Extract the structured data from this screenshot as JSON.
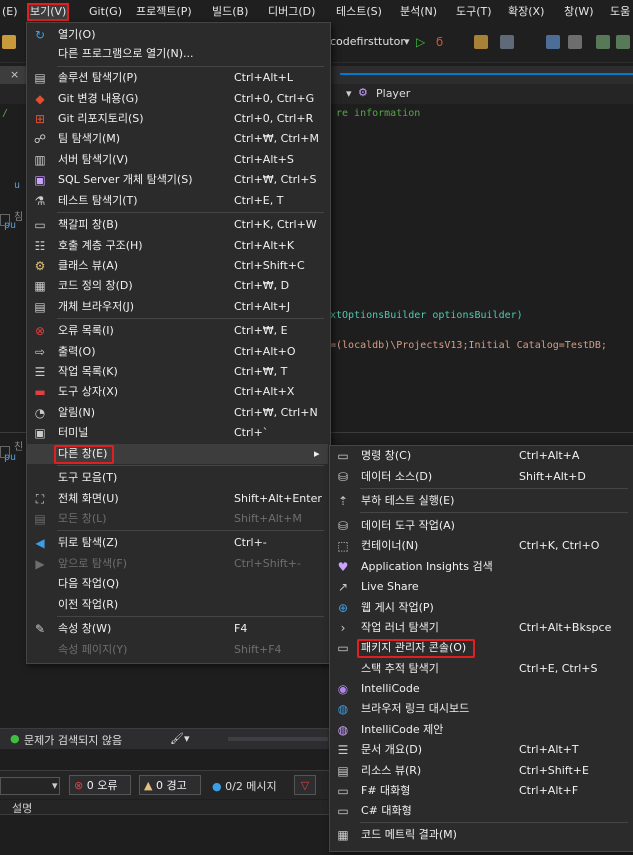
{
  "menubar": {
    "items": [
      "(E)",
      "보기(V)",
      "Git(G)",
      "프로젝트(P)",
      "빌드(B)",
      "디버그(D)",
      "테스트(S)",
      "분석(N)",
      "도구(T)",
      "확장(X)",
      "창(W)",
      "도움"
    ]
  },
  "toolbar": {
    "project": "codefirsttutor"
  },
  "navbar": {
    "member": "Player"
  },
  "code": {
    "line1": "re information",
    "line2": "xtOptionsBuilder optionsBuilder)",
    "line3": "=(localdb)\\ProjectsV13;Initial Catalog=TestDB;",
    "frag_u": "u",
    "frag_g1": "침",
    "frag_g2": "친",
    "frag_p": "pu"
  },
  "view_menu": [
    {
      "label": "열기(O)",
      "shortcut": "",
      "icon": "open-icon",
      "disabled": false
    },
    {
      "label": "다른 프로그램으로 열기(N)...",
      "shortcut": "",
      "icon": "",
      "disabled": false
    },
    {
      "label": "솔루션 탐색기(P)",
      "shortcut": "Ctrl+Alt+L",
      "icon": "solution-explorer-icon",
      "disabled": false
    },
    {
      "label": "Git 변경 내용(G)",
      "shortcut": "Ctrl+0, Ctrl+G",
      "icon": "git-changes-icon",
      "disabled": false
    },
    {
      "label": "Git 리포지토리(S)",
      "shortcut": "Ctrl+0, Ctrl+R",
      "icon": "git-repository-icon",
      "disabled": false
    },
    {
      "label": "팀 탐색기(M)",
      "shortcut": "Ctrl+₩, Ctrl+M",
      "icon": "team-explorer-icon",
      "disabled": false
    },
    {
      "label": "서버 탐색기(V)",
      "shortcut": "Ctrl+Alt+S",
      "icon": "server-explorer-icon",
      "disabled": false
    },
    {
      "label": "SQL Server 개체 탐색기(S)",
      "shortcut": "Ctrl+₩, Ctrl+S",
      "icon": "sql-server-icon",
      "disabled": false
    },
    {
      "label": "테스트 탐색기(T)",
      "shortcut": "Ctrl+E, T",
      "icon": "test-explorer-icon",
      "disabled": false
    },
    {
      "label": "책갈피 창(B)",
      "shortcut": "Ctrl+K, Ctrl+W",
      "icon": "bookmark-icon",
      "disabled": false
    },
    {
      "label": "호출 계층 구조(H)",
      "shortcut": "Ctrl+Alt+K",
      "icon": "call-hierarchy-icon",
      "disabled": false
    },
    {
      "label": "클래스 뷰(A)",
      "shortcut": "Ctrl+Shift+C",
      "icon": "class-view-icon",
      "disabled": false
    },
    {
      "label": "코드 정의 창(D)",
      "shortcut": "Ctrl+₩, D",
      "icon": "code-definition-icon",
      "disabled": false
    },
    {
      "label": "개체 브라우저(J)",
      "shortcut": "Ctrl+Alt+J",
      "icon": "object-browser-icon",
      "disabled": false
    },
    {
      "label": "오류 목록(I)",
      "shortcut": "Ctrl+₩, E",
      "icon": "error-list-icon",
      "disabled": false
    },
    {
      "label": "출력(O)",
      "shortcut": "Ctrl+Alt+O",
      "icon": "output-icon",
      "disabled": false
    },
    {
      "label": "작업 목록(K)",
      "shortcut": "Ctrl+₩, T",
      "icon": "task-list-icon",
      "disabled": false
    },
    {
      "label": "도구 상자(X)",
      "shortcut": "Ctrl+Alt+X",
      "icon": "toolbox-icon",
      "disabled": false
    },
    {
      "label": "알림(N)",
      "shortcut": "Ctrl+₩, Ctrl+N",
      "icon": "bell-icon",
      "disabled": false
    },
    {
      "label": "터미널",
      "shortcut": "Ctrl+`",
      "icon": "terminal-icon",
      "disabled": false
    },
    {
      "label": "다른 창(E)",
      "shortcut": "",
      "icon": "",
      "disabled": false
    },
    {
      "label": "도구 모음(T)",
      "shortcut": "",
      "icon": "",
      "disabled": false
    },
    {
      "label": "전체 화면(U)",
      "shortcut": "Shift+Alt+Enter",
      "icon": "fullscreen-icon",
      "disabled": false
    },
    {
      "label": "모든 창(L)",
      "shortcut": "Shift+Alt+M",
      "icon": "all-windows-icon",
      "disabled": true
    },
    {
      "label": "뒤로 탐색(Z)",
      "shortcut": "Ctrl+-",
      "icon": "back-icon",
      "disabled": false
    },
    {
      "label": "앞으로 탐색(F)",
      "shortcut": "Ctrl+Shift+-",
      "icon": "forward-icon",
      "disabled": true
    },
    {
      "label": "다음 작업(Q)",
      "shortcut": "",
      "icon": "",
      "disabled": false
    },
    {
      "label": "이전 작업(R)",
      "shortcut": "",
      "icon": "",
      "disabled": false
    },
    {
      "label": "속성 창(W)",
      "shortcut": "F4",
      "icon": "wrench-icon",
      "disabled": false
    },
    {
      "label": "속성 페이지(Y)",
      "shortcut": "Shift+F4",
      "icon": "",
      "disabled": true
    }
  ],
  "submenu": [
    {
      "label": "명령 창(C)",
      "shortcut": "Ctrl+Alt+A",
      "icon": "command-window-icon"
    },
    {
      "label": "데이터 소스(D)",
      "shortcut": "Shift+Alt+D",
      "icon": "data-source-icon"
    },
    {
      "label": "부하 테스트 실행(E)",
      "shortcut": "",
      "icon": "load-test-icon"
    },
    {
      "label": "데이터 도구 작업(A)",
      "shortcut": "",
      "icon": "data-tools-icon"
    },
    {
      "label": "컨테이너(N)",
      "shortcut": "Ctrl+K, Ctrl+O",
      "icon": "container-icon"
    },
    {
      "label": "Application Insights 검색",
      "shortcut": "",
      "icon": "app-insights-icon"
    },
    {
      "label": "Live Share",
      "shortcut": "",
      "icon": "live-share-icon"
    },
    {
      "label": "웹 게시 작업(P)",
      "shortcut": "",
      "icon": "web-publish-icon"
    },
    {
      "label": "작업 러너 탐색기",
      "shortcut": "Ctrl+Alt+Bkspce",
      "icon": "chevron-right-icon"
    },
    {
      "label": "패키지 관리자 콘솔(O)",
      "shortcut": "",
      "icon": "package-manager-icon"
    },
    {
      "label": "스택 추적 탐색기",
      "shortcut": "Ctrl+E, Ctrl+S",
      "icon": ""
    },
    {
      "label": "IntelliCode",
      "shortcut": "",
      "icon": "intellicode-icon"
    },
    {
      "label": "브라우저 링크 대시보드",
      "shortcut": "",
      "icon": "browser-link-icon"
    },
    {
      "label": "IntelliCode 제안",
      "shortcut": "",
      "icon": "lightbulb-icon"
    },
    {
      "label": "문서 개요(D)",
      "shortcut": "Ctrl+Alt+T",
      "icon": "document-outline-icon"
    },
    {
      "label": "리소스 뷰(R)",
      "shortcut": "Ctrl+Shift+E",
      "icon": "resource-view-icon"
    },
    {
      "label": "F# 대화형",
      "shortcut": "Ctrl+Alt+F",
      "icon": "fsharp-icon"
    },
    {
      "label": "C# 대화형",
      "shortcut": "",
      "icon": "csharp-icon"
    },
    {
      "label": "코드 메트릭 결과(M)",
      "shortcut": "",
      "icon": "code-metrics-icon"
    }
  ],
  "statusbar": {
    "issues": "문제가 검색되지 않음"
  },
  "errorlist": {
    "errors": "0 오류",
    "warnings": "0 경고",
    "messages": "0/2 메시지",
    "column": "설명"
  },
  "colors": {
    "accent_red": "#e02020",
    "menu_bg": "#2b2b2b",
    "highlight": "#3d3d3d"
  }
}
